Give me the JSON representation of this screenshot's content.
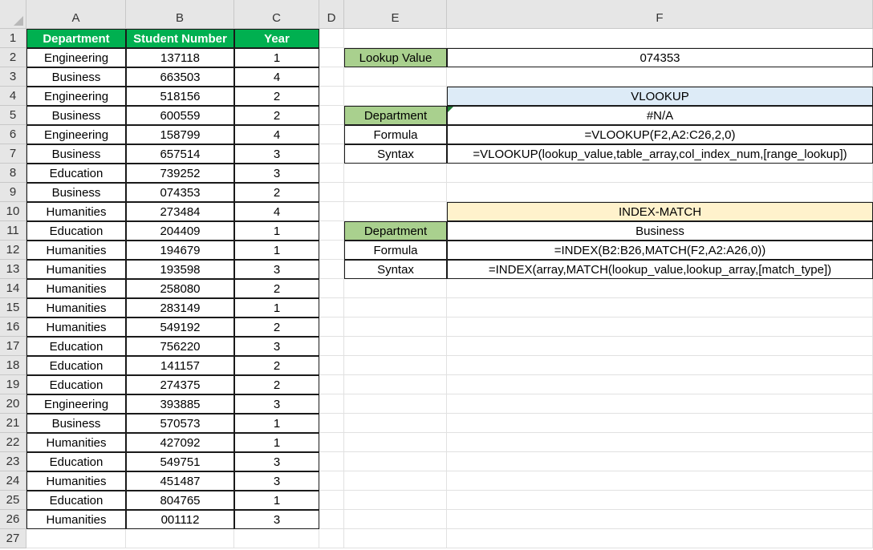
{
  "columns": [
    "A",
    "B",
    "C",
    "D",
    "E",
    "F"
  ],
  "row_numbers": [
    "1",
    "2",
    "3",
    "4",
    "5",
    "6",
    "7",
    "8",
    "9",
    "10",
    "11",
    "12",
    "13",
    "14",
    "15",
    "16",
    "17",
    "18",
    "19",
    "20",
    "21",
    "22",
    "23",
    "24",
    "25",
    "26",
    "27"
  ],
  "table": {
    "headers": [
      "Department",
      "Student Number",
      "Year"
    ],
    "rows": [
      [
        "Engineering",
        "137118",
        "1"
      ],
      [
        "Business",
        "663503",
        "4"
      ],
      [
        "Engineering",
        "518156",
        "2"
      ],
      [
        "Business",
        "600559",
        "2"
      ],
      [
        "Engineering",
        "158799",
        "4"
      ],
      [
        "Business",
        "657514",
        "3"
      ],
      [
        "Education",
        "739252",
        "3"
      ],
      [
        "Business",
        "074353",
        "2"
      ],
      [
        "Humanities",
        "273484",
        "4"
      ],
      [
        "Education",
        "204409",
        "1"
      ],
      [
        "Humanities",
        "194679",
        "1"
      ],
      [
        "Humanities",
        "193598",
        "3"
      ],
      [
        "Humanities",
        "258080",
        "2"
      ],
      [
        "Humanities",
        "283149",
        "1"
      ],
      [
        "Humanities",
        "549192",
        "2"
      ],
      [
        "Education",
        "756220",
        "3"
      ],
      [
        "Education",
        "141157",
        "2"
      ],
      [
        "Education",
        "274375",
        "2"
      ],
      [
        "Engineering",
        "393885",
        "3"
      ],
      [
        "Business",
        "570573",
        "1"
      ],
      [
        "Humanities",
        "427092",
        "1"
      ],
      [
        "Education",
        "549751",
        "3"
      ],
      [
        "Humanities",
        "451487",
        "3"
      ],
      [
        "Education",
        "804765",
        "1"
      ],
      [
        "Humanities",
        "001112",
        "3"
      ]
    ]
  },
  "lookup": {
    "label": "Lookup Value",
    "value": "074353"
  },
  "vlookup": {
    "title": "VLOOKUP",
    "rows": [
      {
        "label": "Department",
        "value": "#N/A"
      },
      {
        "label": "Formula",
        "value": "=VLOOKUP(F2,A2:C26,2,0)"
      },
      {
        "label": "Syntax",
        "value": "=VLOOKUP(lookup_value,table_array,col_index_num,[range_lookup])"
      }
    ]
  },
  "index_match": {
    "title": "INDEX-MATCH",
    "rows": [
      {
        "label": "Department",
        "value": "Business"
      },
      {
        "label": "Formula",
        "value": "=INDEX(B2:B26,MATCH(F2,A2:A26,0))"
      },
      {
        "label": "Syntax",
        "value": "=INDEX(array,MATCH(lookup_value,lookup_array,[match_type])"
      }
    ]
  },
  "colors": {
    "header_green": "#00b050",
    "label_green": "#a9d08e",
    "vlookup_blue": "#ddebf7",
    "index_yellow": "#fff2cc",
    "error_indicator": "#1e7b34"
  }
}
